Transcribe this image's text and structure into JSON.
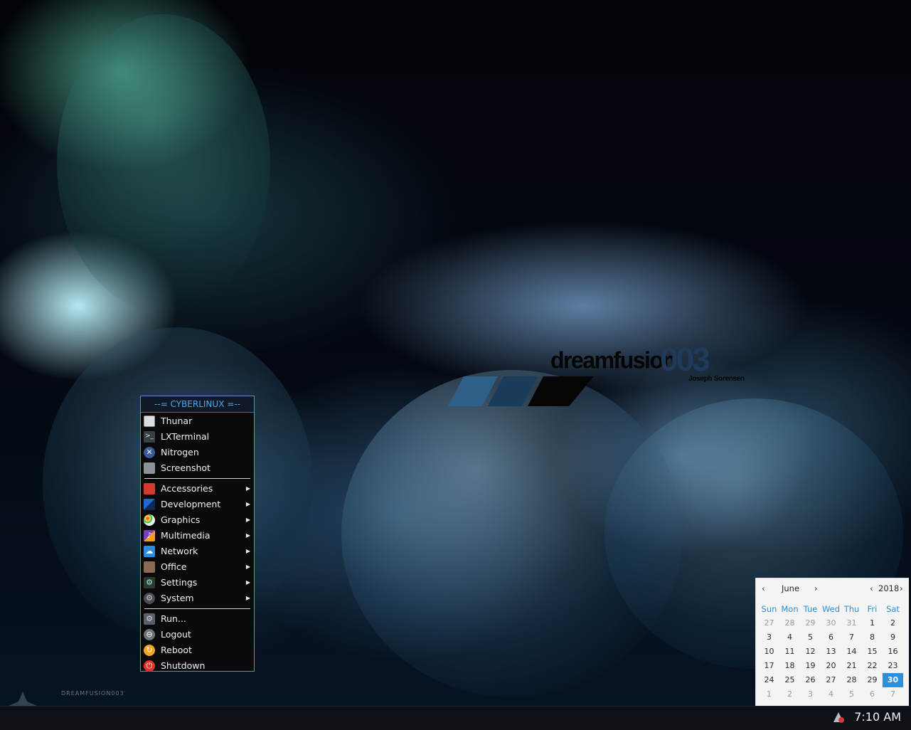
{
  "desktop": {
    "wallpaper": {
      "title": "dreamfusion",
      "number": "003",
      "author": "Joseph Sorensen",
      "corner_text": "DREAMFUSION003"
    }
  },
  "menu": {
    "title": "--= CYBERLINUX =--",
    "apps": [
      {
        "label": "Thunar",
        "icon": "folder-icon"
      },
      {
        "label": "LXTerminal",
        "icon": "terminal-icon"
      },
      {
        "label": "Nitrogen",
        "icon": "nitrogen-icon"
      },
      {
        "label": "Screenshot",
        "icon": "camera-icon"
      }
    ],
    "categories": [
      {
        "label": "Accessories",
        "icon": "accessories-icon"
      },
      {
        "label": "Development",
        "icon": "development-icon"
      },
      {
        "label": "Graphics",
        "icon": "palette-icon"
      },
      {
        "label": "Multimedia",
        "icon": "multimedia-icon"
      },
      {
        "label": "Network",
        "icon": "cloud-icon"
      },
      {
        "label": "Office",
        "icon": "briefcase-icon"
      },
      {
        "label": "Settings",
        "icon": "settings-icon"
      },
      {
        "label": "System",
        "icon": "gear-icon"
      }
    ],
    "actions": [
      {
        "label": "Run...",
        "icon": "run-icon"
      },
      {
        "label": "Logout",
        "icon": "logout-icon"
      },
      {
        "label": "Reboot",
        "icon": "reboot-icon"
      },
      {
        "label": "Shutdown",
        "icon": "power-icon"
      }
    ]
  },
  "calendar": {
    "month": "June",
    "year": "2018",
    "weekdays": [
      "Sun",
      "Mon",
      "Tue",
      "Wed",
      "Thu",
      "Fri",
      "Sat"
    ],
    "weeks": [
      [
        "27",
        "28",
        "29",
        "30",
        "31",
        "1",
        "2"
      ],
      [
        "3",
        "4",
        "5",
        "6",
        "7",
        "8",
        "9"
      ],
      [
        "10",
        "11",
        "12",
        "13",
        "14",
        "15",
        "16"
      ],
      [
        "17",
        "18",
        "19",
        "20",
        "21",
        "22",
        "23"
      ],
      [
        "24",
        "25",
        "26",
        "27",
        "28",
        "29",
        "30"
      ],
      [
        "1",
        "2",
        "3",
        "4",
        "5",
        "6",
        "7"
      ]
    ],
    "muted_first_row_count": 5,
    "muted_last_row": true,
    "selected_day": "30",
    "accent_color": "#2d8fd9"
  },
  "panel": {
    "clock": "7:10 AM",
    "tray_icon": "network-tray-icon"
  },
  "colors": {
    "menu_border": "#5a8fc6",
    "menu_title": "#4fa6e8"
  }
}
